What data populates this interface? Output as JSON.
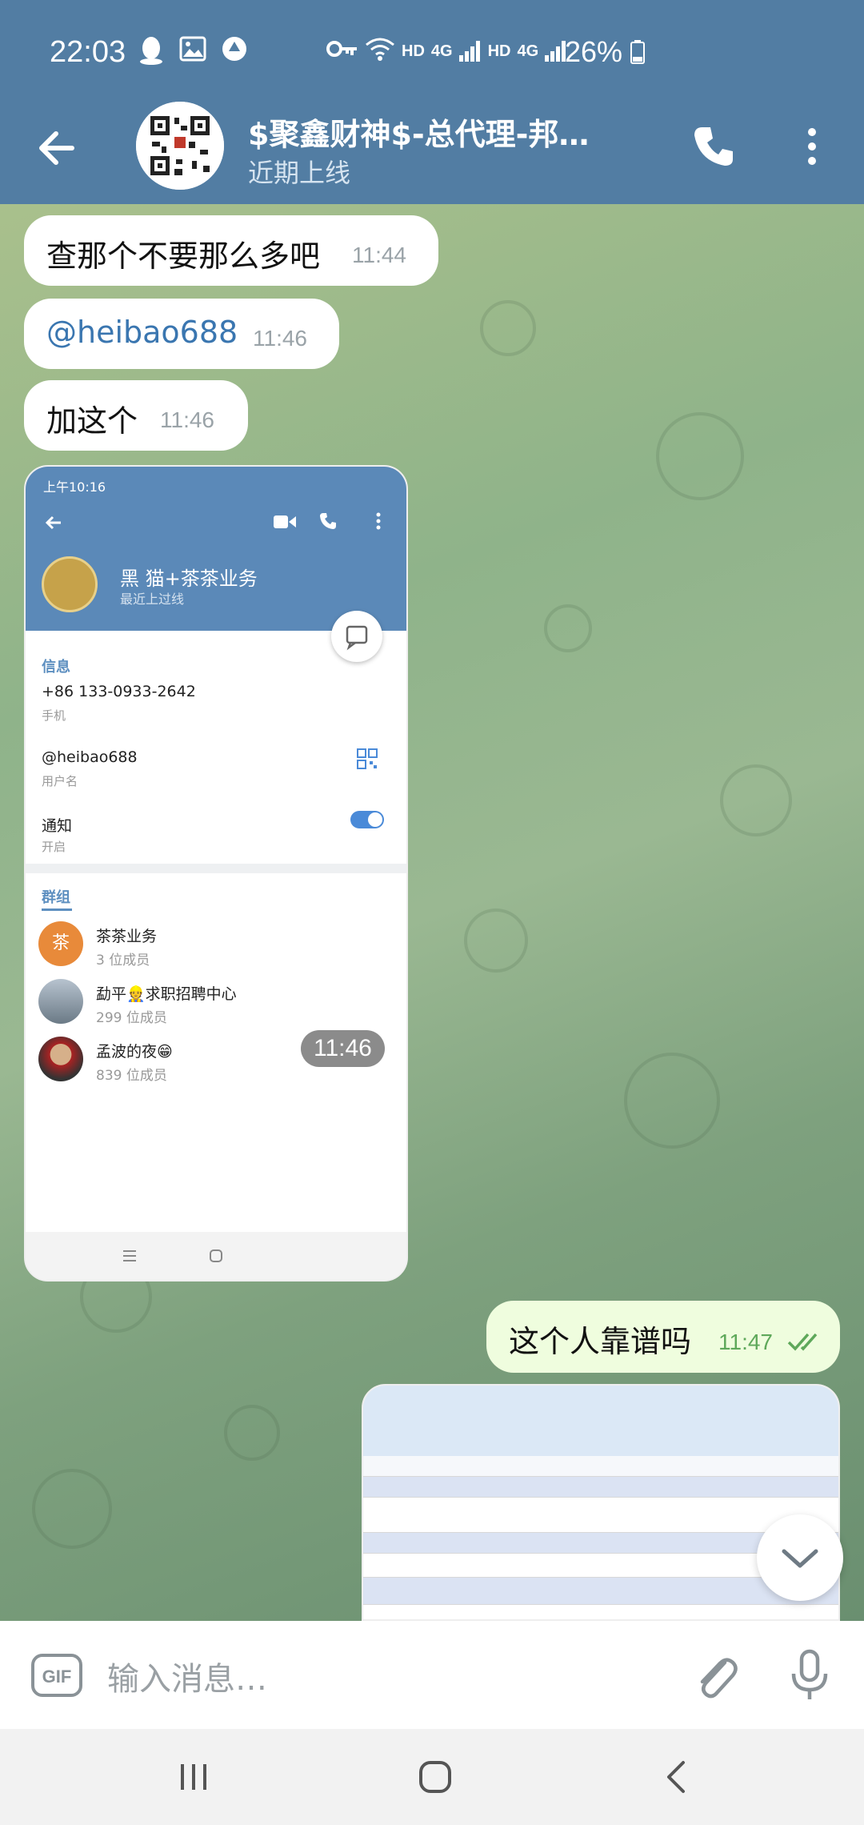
{
  "status_bar": {
    "time": "22:03",
    "network": "HD",
    "network_type": "4G",
    "network2": "HD",
    "network_type2": "4G",
    "battery": "26%"
  },
  "header": {
    "title": "$聚鑫财神$-总代理-邦…",
    "subtitle": "近期上线"
  },
  "messages": [
    {
      "text": "查那个不要那么多吧",
      "time": "11:44"
    },
    {
      "text": "@heibao688",
      "time": "11:46"
    },
    {
      "text": "加这个",
      "time": "11:46"
    },
    {
      "time": "11:46"
    },
    {
      "text": "这个人靠谱吗",
      "time": "11:47"
    }
  ],
  "shared_screenshot": {
    "status_time": "上午10:16",
    "name": "黑 猫+茶茶业务",
    "last_seen": "最近上过线",
    "info_label": "信息",
    "phone": "+86 133-0933-2642",
    "phone_cap": "手机",
    "username": "@heibao688",
    "username_cap": "用户名",
    "notify": "通知",
    "notify_cap": "开启",
    "groups_label": "群组",
    "groups": [
      {
        "name": "茶茶业务",
        "members": "3 位成员",
        "avatar_text": "茶"
      },
      {
        "name": "勐平👷求职招聘中心",
        "members": "299 位成员"
      },
      {
        "name": "孟波的夜😁",
        "members": "839 位成员"
      }
    ]
  },
  "input": {
    "placeholder": "输入消息…"
  },
  "colors": {
    "header_bg": "#527da3",
    "outgoing_bubble": "#effdde",
    "incoming_bubble": "#ffffff",
    "link": "#3a76b0"
  }
}
